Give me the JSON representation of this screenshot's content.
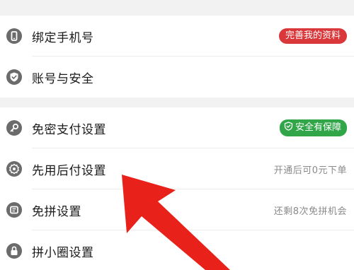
{
  "sections": {
    "account": {
      "bind_phone": {
        "label": "绑定手机号",
        "badge": "完善我的资料",
        "icon": "phone-icon"
      },
      "account_security": {
        "label": "账号与安全",
        "icon": "shield-check-icon"
      }
    },
    "payment": {
      "password_free": {
        "label": "免密支付设置",
        "badge": "安全有保障",
        "icon": "key-icon",
        "badge_icon": "shield-check-icon"
      },
      "pay_later": {
        "label": "先用后付设置",
        "hint": "开通后可0元下单",
        "icon": "badge-icon"
      },
      "group_free": {
        "label": "免拼设置",
        "hint": "还剩8次免拼机会",
        "icon": "ticket-icon"
      },
      "circle": {
        "label": "拼小圈设置",
        "icon": "lock-icon"
      }
    }
  },
  "colors": {
    "red_badge": "#d9373a",
    "green_badge": "#31a648",
    "arrow": "#e8221b",
    "icon_gray": "#6b6b6b"
  }
}
